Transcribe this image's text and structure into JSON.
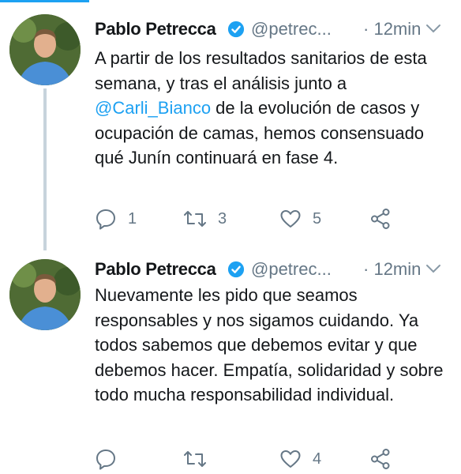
{
  "tweets": [
    {
      "author": "Pablo Petrecca",
      "handle": "@petrec...",
      "dot": "·",
      "time": "12min",
      "text_parts": [
        "A partir de los resultados sanitarios de esta semana, y tras el análisis junto a ",
        "@Carli_Bianco",
        " de la evolución de casos y ocupación de camas, hemos consensuado qué Junín continuará en fase 4."
      ],
      "replies": "1",
      "retweets": "3",
      "likes": "5"
    },
    {
      "author": "Pablo Petrecca",
      "handle": "@petrec...",
      "dot": "·",
      "time": "12min",
      "text": "Nuevamente les pido que seamos responsables y nos sigamos cuidando. Ya todos sabemos que debemos evitar y que debemos hacer. Empatía, solidaridad y sobre todo mucha responsabilidad individual.",
      "replies": "",
      "retweets": "",
      "likes": "4"
    }
  ],
  "colors": {
    "accent": "#1da1f2",
    "text": "#14171a",
    "muted": "#657786",
    "thread_line": "#c7d3dc"
  },
  "icons": [
    "reply-icon",
    "retweet-icon",
    "like-icon",
    "share-icon",
    "verified-badge-icon",
    "chevron-down-icon"
  ]
}
